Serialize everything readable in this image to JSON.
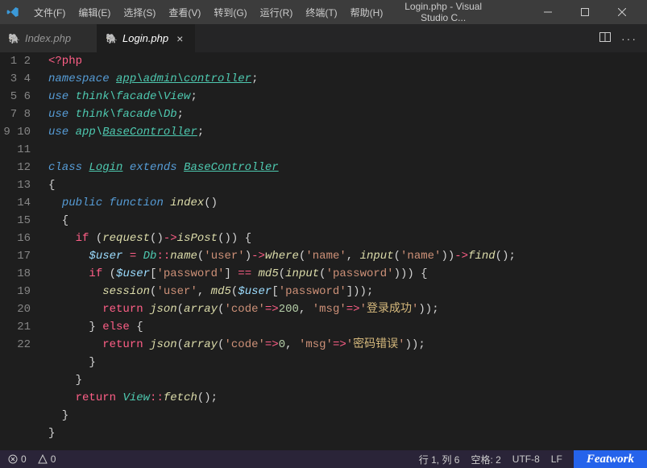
{
  "menu": [
    "文件(F)",
    "编辑(E)",
    "选择(S)",
    "查看(V)",
    "转到(G)",
    "运行(R)",
    "终端(T)",
    "帮助(H)"
  ],
  "window_title": "Login.php - Visual Studio C...",
  "tabs": [
    {
      "icon": "🐘",
      "label": "Index.php",
      "active": false
    },
    {
      "icon": "🐘",
      "label": "Login.php",
      "active": true
    }
  ],
  "code_lines": [
    [
      [
        "c-red",
        "<?php"
      ]
    ],
    [
      [
        "c-blue",
        "namespace"
      ],
      [
        "c-pun",
        " "
      ],
      [
        "c-teal-u",
        "app\\admin\\controller"
      ],
      [
        "c-pun",
        ";"
      ]
    ],
    [
      [
        "c-blue",
        "use"
      ],
      [
        "c-pun",
        " "
      ],
      [
        "c-teal",
        "think\\facade\\View"
      ],
      [
        "c-pun",
        ";"
      ]
    ],
    [
      [
        "c-blue",
        "use"
      ],
      [
        "c-pun",
        " "
      ],
      [
        "c-teal",
        "think\\facade\\Db"
      ],
      [
        "c-pun",
        ";"
      ]
    ],
    [
      [
        "c-blue",
        "use"
      ],
      [
        "c-pun",
        " "
      ],
      [
        "c-teal",
        "app\\"
      ],
      [
        "c-teal-u",
        "BaseController"
      ],
      [
        "c-pun",
        ";"
      ]
    ],
    [],
    [
      [
        "c-blue",
        "class"
      ],
      [
        "c-pun",
        " "
      ],
      [
        "c-teal-u",
        "Login"
      ],
      [
        "c-pun",
        " "
      ],
      [
        "c-blue",
        "extends"
      ],
      [
        "c-pun",
        " "
      ],
      [
        "c-teal-u",
        "BaseController"
      ]
    ],
    [
      [
        "c-pun",
        "{"
      ]
    ],
    [
      [
        "c-pun",
        "  "
      ],
      [
        "c-blue",
        "public"
      ],
      [
        "c-pun",
        " "
      ],
      [
        "c-blue",
        "function"
      ],
      [
        "c-pun",
        " "
      ],
      [
        "c-yellow",
        "index"
      ],
      [
        "c-pun",
        "()"
      ]
    ],
    [
      [
        "c-pun",
        "  {"
      ]
    ],
    [
      [
        "c-pun",
        "    "
      ],
      [
        "c-op",
        "if"
      ],
      [
        "c-pun",
        " ("
      ],
      [
        "c-yellow",
        "request"
      ],
      [
        "c-pun",
        "()"
      ],
      [
        "c-op",
        "->"
      ],
      [
        "c-yellow",
        "isPost"
      ],
      [
        "c-pun",
        "()) {"
      ]
    ],
    [
      [
        "c-pun",
        "      "
      ],
      [
        "c-var",
        "$user"
      ],
      [
        "c-pun",
        " "
      ],
      [
        "c-op",
        "="
      ],
      [
        "c-pun",
        " "
      ],
      [
        "c-teal",
        "Db"
      ],
      [
        "c-op",
        "::"
      ],
      [
        "c-yellow",
        "name"
      ],
      [
        "c-pun",
        "("
      ],
      [
        "c-str",
        "'user'"
      ],
      [
        "c-pun",
        ")"
      ],
      [
        "c-op",
        "->"
      ],
      [
        "c-yellow",
        "where"
      ],
      [
        "c-pun",
        "("
      ],
      [
        "c-str",
        "'name'"
      ],
      [
        "c-pun",
        ", "
      ],
      [
        "c-yellow",
        "input"
      ],
      [
        "c-pun",
        "("
      ],
      [
        "c-str",
        "'name'"
      ],
      [
        "c-pun",
        "))"
      ],
      [
        "c-op",
        "->"
      ],
      [
        "c-yellow",
        "find"
      ],
      [
        "c-pun",
        "();"
      ]
    ],
    [
      [
        "c-pun",
        "      "
      ],
      [
        "c-op",
        "if"
      ],
      [
        "c-pun",
        " ("
      ],
      [
        "c-var",
        "$user"
      ],
      [
        "c-pun",
        "["
      ],
      [
        "c-str",
        "'password'"
      ],
      [
        "c-pun",
        "] "
      ],
      [
        "c-op",
        "=="
      ],
      [
        "c-pun",
        " "
      ],
      [
        "c-yellow",
        "md5"
      ],
      [
        "c-pun",
        "("
      ],
      [
        "c-yellow",
        "input"
      ],
      [
        "c-pun",
        "("
      ],
      [
        "c-str",
        "'password'"
      ],
      [
        "c-pun",
        "))) {"
      ]
    ],
    [
      [
        "c-pun",
        "        "
      ],
      [
        "c-yellow",
        "session"
      ],
      [
        "c-pun",
        "("
      ],
      [
        "c-str",
        "'user'"
      ],
      [
        "c-pun",
        ", "
      ],
      [
        "c-yellow",
        "md5"
      ],
      [
        "c-pun",
        "("
      ],
      [
        "c-var",
        "$user"
      ],
      [
        "c-pun",
        "["
      ],
      [
        "c-str",
        "'password'"
      ],
      [
        "c-pun",
        "]));"
      ]
    ],
    [
      [
        "c-pun",
        "        "
      ],
      [
        "c-op",
        "return"
      ],
      [
        "c-pun",
        " "
      ],
      [
        "c-yellow",
        "json"
      ],
      [
        "c-pun",
        "("
      ],
      [
        "c-yellow",
        "array"
      ],
      [
        "c-pun",
        "("
      ],
      [
        "c-str",
        "'code'"
      ],
      [
        "c-op",
        "=>"
      ],
      [
        "c-num",
        "200"
      ],
      [
        "c-pun",
        ", "
      ],
      [
        "c-str",
        "'msg'"
      ],
      [
        "c-op",
        "=>"
      ],
      [
        "c-str",
        "'"
      ],
      [
        "c-cn",
        "登录成功"
      ],
      [
        "c-str",
        "'"
      ],
      [
        "c-pun",
        "));"
      ]
    ],
    [
      [
        "c-pun",
        "      } "
      ],
      [
        "c-op",
        "else"
      ],
      [
        "c-pun",
        " {"
      ]
    ],
    [
      [
        "c-pun",
        "        "
      ],
      [
        "c-op",
        "return"
      ],
      [
        "c-pun",
        " "
      ],
      [
        "c-yellow",
        "json"
      ],
      [
        "c-pun",
        "("
      ],
      [
        "c-yellow",
        "array"
      ],
      [
        "c-pun",
        "("
      ],
      [
        "c-str",
        "'code'"
      ],
      [
        "c-op",
        "=>"
      ],
      [
        "c-num",
        "0"
      ],
      [
        "c-pun",
        ", "
      ],
      [
        "c-str",
        "'msg'"
      ],
      [
        "c-op",
        "=>"
      ],
      [
        "c-str",
        "'"
      ],
      [
        "c-cn",
        "密码错误"
      ],
      [
        "c-str",
        "'"
      ],
      [
        "c-pun",
        "));"
      ]
    ],
    [
      [
        "c-pun",
        "      }"
      ]
    ],
    [
      [
        "c-pun",
        "    }"
      ]
    ],
    [
      [
        "c-pun",
        "    "
      ],
      [
        "c-op",
        "return"
      ],
      [
        "c-pun",
        " "
      ],
      [
        "c-teal",
        "View"
      ],
      [
        "c-op",
        "::"
      ],
      [
        "c-yellow",
        "fetch"
      ],
      [
        "c-pun",
        "();"
      ]
    ],
    [
      [
        "c-pun",
        "  }"
      ]
    ],
    [
      [
        "c-pun",
        "}"
      ]
    ]
  ],
  "status": {
    "errors": "0",
    "warnings": "0",
    "pos": "行 1, 列 6",
    "spaces": "空格: 2",
    "encoding": "UTF-8",
    "eol": "LF",
    "brand": "Featwork"
  }
}
